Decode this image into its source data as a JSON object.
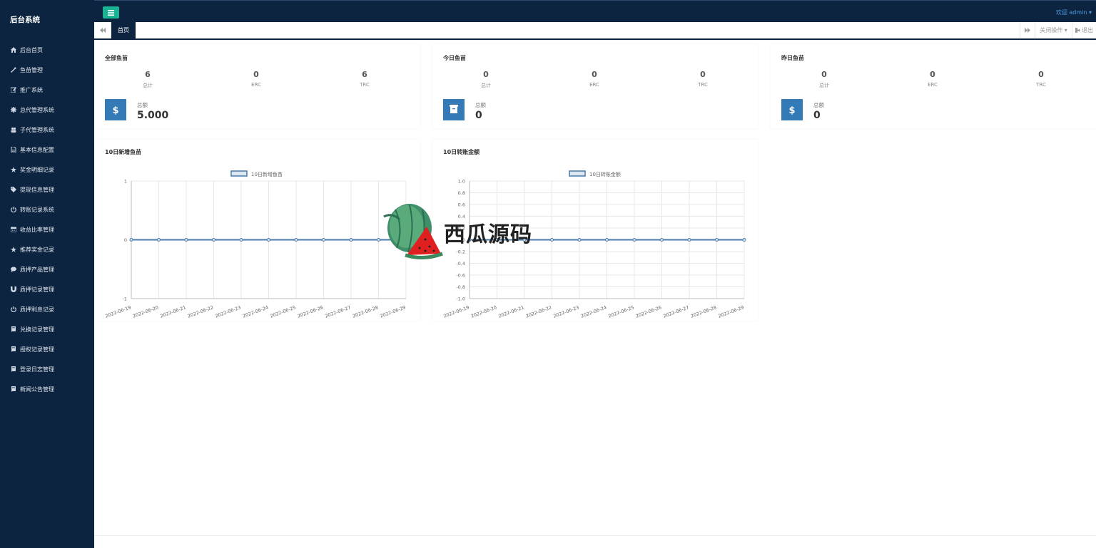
{
  "app": {
    "title": "后台系统"
  },
  "sidebar": {
    "items": [
      {
        "label": "后台首页",
        "icon": "home-icon"
      },
      {
        "label": "鱼苗管理",
        "icon": "wrench-icon"
      },
      {
        "label": "推广系统",
        "icon": "edit-icon"
      },
      {
        "label": "总代管理系统",
        "icon": "asterisk-icon"
      },
      {
        "label": "子代管理系统",
        "icon": "users-icon"
      },
      {
        "label": "基本信息配置",
        "icon": "file-icon"
      },
      {
        "label": "奖金明细记录",
        "icon": "star-icon"
      },
      {
        "label": "提现信息管理",
        "icon": "tag-icon"
      },
      {
        "label": "转账记录系统",
        "icon": "power-icon"
      },
      {
        "label": "收益比率管理",
        "icon": "calendar-icon"
      },
      {
        "label": "推荐奖金记录",
        "icon": "star-icon"
      },
      {
        "label": "质押产品管理",
        "icon": "comment-icon"
      },
      {
        "label": "质押记录管理",
        "icon": "magnet-icon"
      },
      {
        "label": "质押利息记录",
        "icon": "power-icon"
      },
      {
        "label": "兑换记录管理",
        "icon": "book-icon"
      },
      {
        "label": "授权记录管理",
        "icon": "book-icon"
      },
      {
        "label": "登录日志管理",
        "icon": "book-icon"
      },
      {
        "label": "新闻公告管理",
        "icon": "book-icon"
      }
    ]
  },
  "topbar": {
    "welcome": "欢迎 admin ▾"
  },
  "tabs": {
    "home": "首页",
    "close_ops": "关闭操作 ▾",
    "logout": "退出"
  },
  "panels": [
    {
      "title": "全部鱼苗",
      "stats": [
        {
          "value": "6",
          "label": "总计"
        },
        {
          "value": "0",
          "label": "ERC"
        },
        {
          "value": "6",
          "label": "TRC"
        }
      ],
      "total_label": "总额",
      "total_value": "5.000",
      "icon": "dollar-icon"
    },
    {
      "title": "今日鱼苗",
      "stats": [
        {
          "value": "0",
          "label": "总计"
        },
        {
          "value": "0",
          "label": "ERC"
        },
        {
          "value": "0",
          "label": "TRC"
        }
      ],
      "total_label": "总额",
      "total_value": "0",
      "icon": "archive-icon"
    },
    {
      "title": "昨日鱼苗",
      "stats": [
        {
          "value": "0",
          "label": "总计"
        },
        {
          "value": "0",
          "label": "ERC"
        },
        {
          "value": "0",
          "label": "TRC"
        }
      ],
      "total_label": "总额",
      "total_value": "0",
      "icon": "dollar-icon"
    }
  ],
  "chart_data": [
    {
      "type": "line",
      "title": "10日新增鱼苗",
      "x": [
        "2022-06-19",
        "2022-06-20",
        "2022-06-21",
        "2022-06-22",
        "2022-06-23",
        "2022-06-24",
        "2022-06-25",
        "2022-06-26",
        "2022-06-27",
        "2022-06-28",
        "2022-06-29"
      ],
      "series": [
        {
          "name": "10日新增鱼苗",
          "values": [
            0,
            0,
            0,
            0,
            0,
            0,
            0,
            0,
            0,
            0,
            0
          ]
        }
      ],
      "ylim": [
        -1,
        1
      ],
      "yticks": [
        "1",
        "0",
        "-1"
      ],
      "grid": true,
      "legend": "top-center",
      "color": "#4a7aa8"
    },
    {
      "type": "line",
      "title": "10日转账金额",
      "x": [
        "2022-06-19",
        "2022-06-20",
        "2022-06-21",
        "2022-06-22",
        "2022-06-23",
        "2022-06-24",
        "2022-06-25",
        "2022-06-26",
        "2022-06-27",
        "2022-06-28",
        "2022-06-29"
      ],
      "series": [
        {
          "name": "10日转账金额",
          "values": [
            0,
            0,
            0,
            0,
            0,
            0,
            0,
            0,
            0,
            0,
            0
          ]
        }
      ],
      "ylim": [
        -1,
        1
      ],
      "yticks": [
        "1.0",
        "0.8",
        "0.6",
        "0.4",
        "0.2",
        "0",
        "-0.2",
        "-0.4",
        "-0.6",
        "-0.8",
        "-1.0"
      ],
      "grid": true,
      "legend": "top-center",
      "color": "#4a7aa8"
    }
  ],
  "watermark": {
    "text": "西瓜源码"
  },
  "colors": {
    "sidebar_bg": "#0c2440",
    "accent_green": "#1ab394",
    "icon_blue": "#337ab7"
  }
}
